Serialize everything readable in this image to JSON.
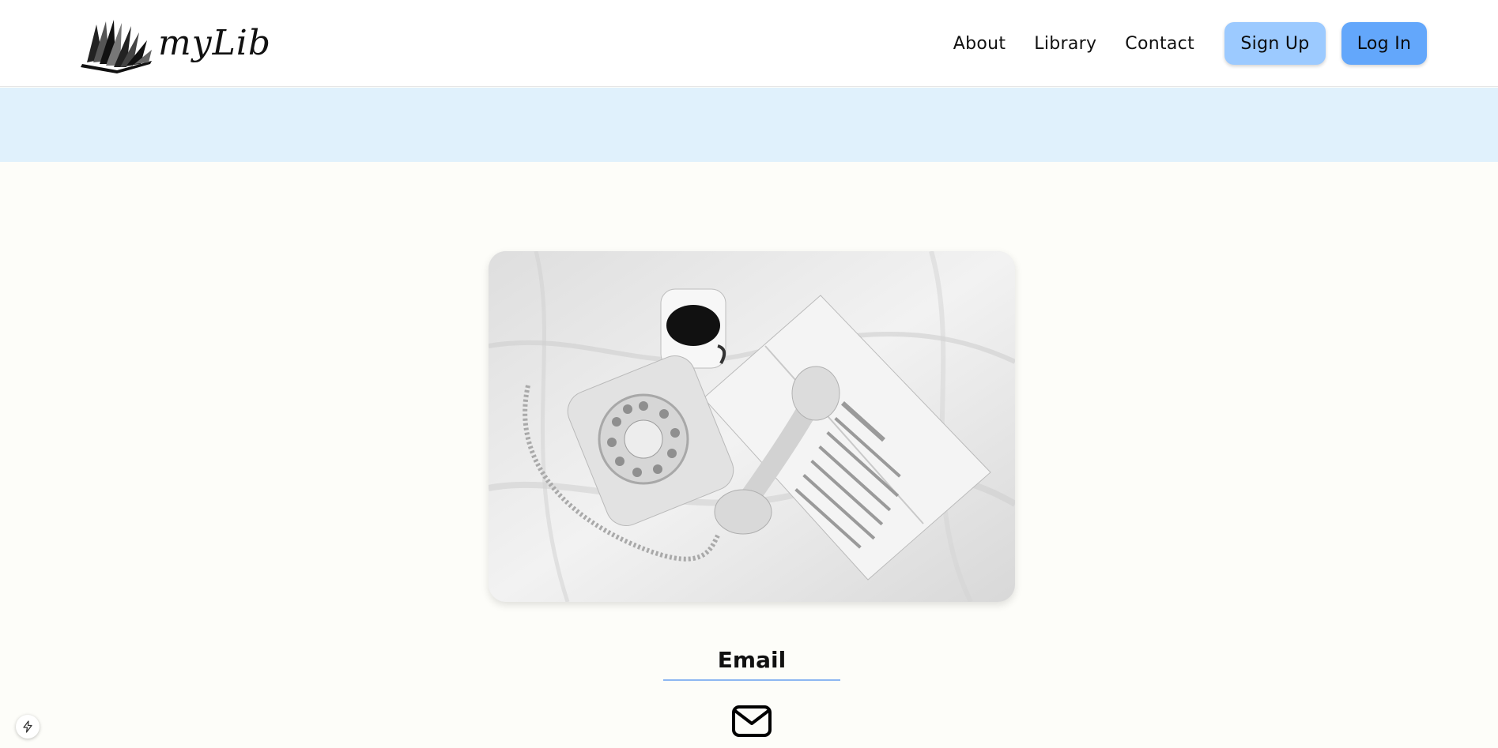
{
  "header": {
    "logo_text": "myLib",
    "nav": {
      "about": "About",
      "library": "Library",
      "contact": "Contact"
    },
    "signup_label": "Sign Up",
    "login_label": "Log In"
  },
  "colors": {
    "banner": "#e0f1fc",
    "signup_bg": "#9ccaff",
    "login_bg": "#63a7fb",
    "page_bg": "#fdfdf9"
  },
  "main": {
    "photo_icon": "telephone-coffee-book-photo",
    "contact_title": "Email",
    "contact_icon": "envelope-icon"
  },
  "floating": {
    "badge_icon": "lightning-icon"
  }
}
